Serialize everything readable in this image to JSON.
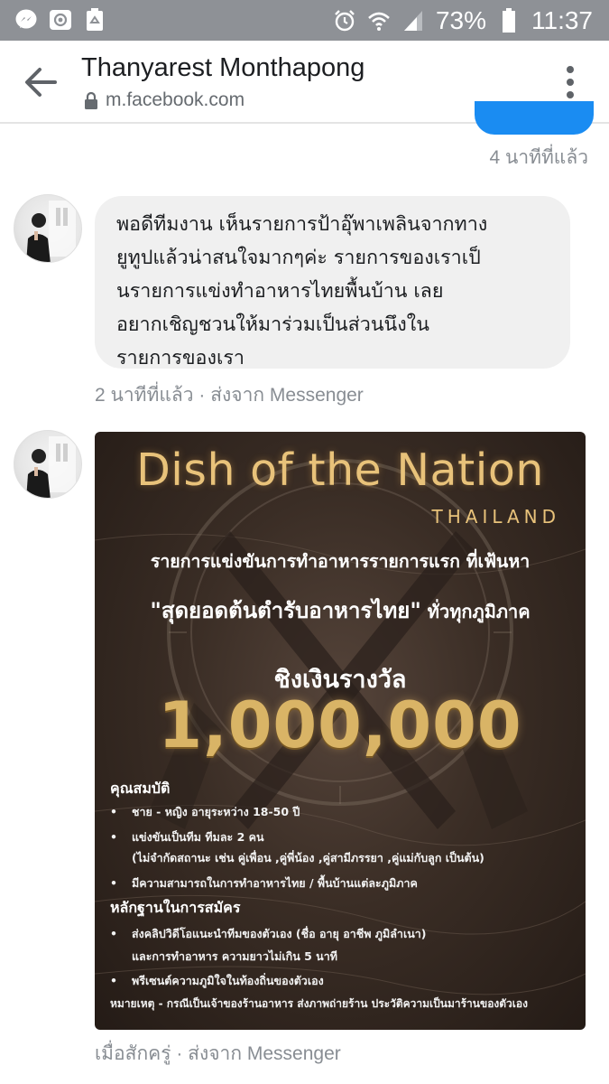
{
  "status_bar": {
    "battery_percent": "73%",
    "time": "11:37",
    "left_icons": [
      "messenger-icon",
      "at-sign-icon",
      "recycle-icon"
    ],
    "right_icons": [
      "alarm-icon",
      "wifi-icon",
      "signal-icon",
      "battery-icon"
    ]
  },
  "header": {
    "title": "Thanyarest Monthapong",
    "url": "m.facebook.com"
  },
  "chat": {
    "previous_timestamp": "4 นาทีที่แล้ว",
    "messages": [
      {
        "lines": [
          "พอดีทีมงาน เห็นรายการป้าอุ๊พาเพลินจากทาง",
          "ยูทูปแล้วน่าสนใจมากๆค่ะ รายการของเราเป็",
          "นรายการแข่งทำอาหารไทยพื้นบ้าน เลย",
          "อยากเชิญชวนให้มาร่วมเป็นส่วนนึงใน",
          "รายการของเรา"
        ],
        "meta": "2 นาทีที่แล้ว · ส่งจาก Messenger"
      },
      {
        "image": {
          "title": "Dish of the Nation",
          "country": "THAILAND",
          "line1": "รายการแข่งขันการทำอาหารรายการแรก ที่เฟ้นหา",
          "line2_quote": "\"สุดยอดต้นตำรับอาหารไทย\"",
          "line2_rest": "ทั่วทุกภูมิภาค",
          "prize_label": "ชิงเงินรางวัล",
          "prize_amount": "1,000,000",
          "qualifications_heading": "คุณสมบัติ",
          "qualifications": [
            "ชาย - หญิง อายุระหว่าง 18-50 ปี",
            "แข่งขันเป็นทีม ทีมละ 2 คน",
            "มีความสามารถในการทำอาหารไทย / พื้นบ้านแต่ละภูมิภาค"
          ],
          "qualification_note": "(ไม่จำกัดสถานะ เช่น คู่เพื่อน ,คู่พี่น้อง ,คู่สามีภรรยา ,คู่แม่กับลูก เป็นต้น)",
          "evidence_heading": "หลักฐานในการสมัคร",
          "evidence": [
            "ส่งคลิปวิดีโอแนะนำทีมของตัวเอง (ชื่อ อายุ อาชีพ ภูมิลำเนา)",
            "พรีเซนต์ความภูมิใจในท้องถิ่นของตัวเอง"
          ],
          "evidence_note": "และการทำอาหาร ความยาวไม่เกิน 5 นาที",
          "footnote": "หมายเหตุ - กรณีเป็นเจ้าของร้านอาหาร ส่งภาพถ่ายร้าน ประวัติความเป็นมาร้านของตัวเอง"
        },
        "meta": "เมื่อสักครู่ · ส่งจาก Messenger"
      }
    ]
  },
  "colors": {
    "status_bar_bg": "#8e9196",
    "accent_blue": "#1a8cf2",
    "bubble_bg": "#f0f0f0",
    "meta_text": "#888d93",
    "poster_gold": "#d9b466"
  }
}
